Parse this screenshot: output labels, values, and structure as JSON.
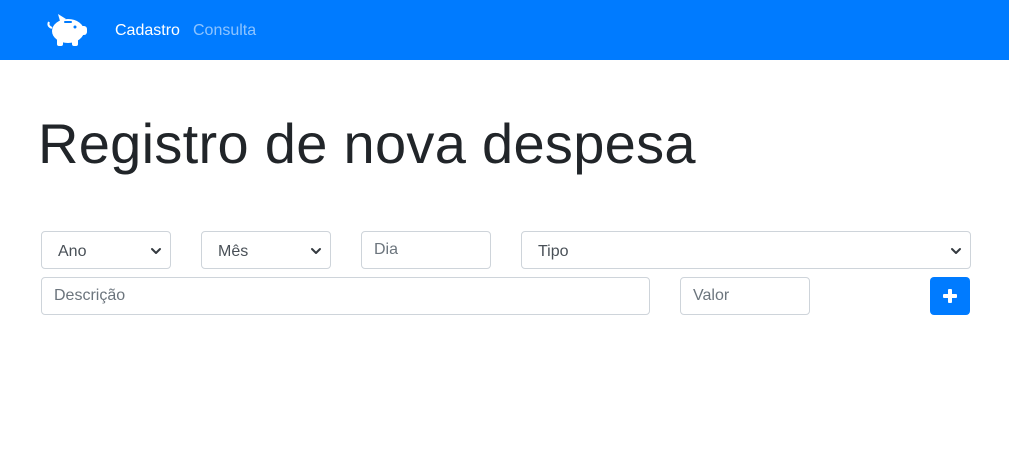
{
  "navbar": {
    "logo_icon": "piggy-bank-icon",
    "links": [
      {
        "label": "Cadastro",
        "active": true
      },
      {
        "label": "Consulta",
        "active": false
      }
    ],
    "background_color": "#007bff"
  },
  "main": {
    "title": "Registro de nova despesa"
  },
  "form": {
    "ano_select": {
      "selected": "Ano"
    },
    "mes_select": {
      "selected": "Mês"
    },
    "dia_input": {
      "value": "",
      "placeholder": "Dia"
    },
    "tipo_select": {
      "selected": "Tipo"
    },
    "descricao_input": {
      "value": "",
      "placeholder": "Descrição"
    },
    "valor_input": {
      "value": "",
      "placeholder": "Valor"
    },
    "add_button": {
      "icon": "plus-icon",
      "color": "#007bff"
    }
  }
}
